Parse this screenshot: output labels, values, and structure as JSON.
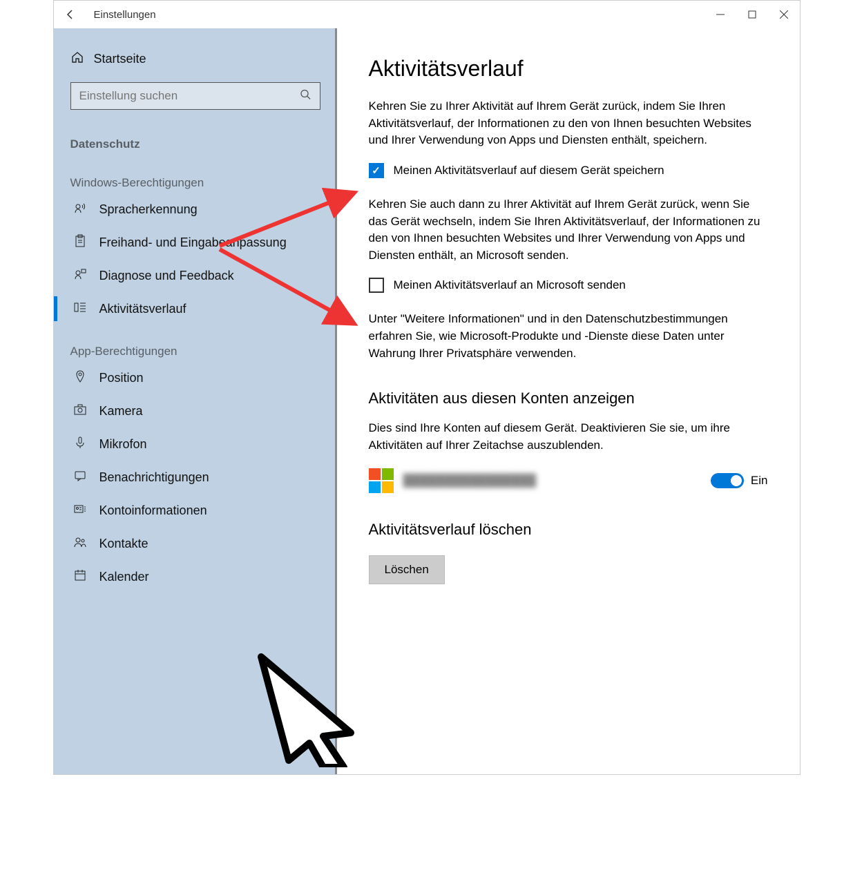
{
  "window": {
    "title": "Einstellungen"
  },
  "sidebar": {
    "home": "Startseite",
    "search_placeholder": "Einstellung suchen",
    "privacy_label": "Datenschutz",
    "section_windows": "Windows-Berechtigungen",
    "section_app": "App-Berechtigungen",
    "items_windows": [
      {
        "label": "Spracherkennung"
      },
      {
        "label": "Freihand- und Eingabeanpassung"
      },
      {
        "label": "Diagnose und Feedback"
      },
      {
        "label": "Aktivitätsverlauf"
      }
    ],
    "items_app": [
      {
        "label": "Position"
      },
      {
        "label": "Kamera"
      },
      {
        "label": "Mikrofon"
      },
      {
        "label": "Benachrichtigungen"
      },
      {
        "label": "Kontoinformationen"
      },
      {
        "label": "Kontakte"
      },
      {
        "label": "Kalender"
      }
    ]
  },
  "main": {
    "h1": "Aktivitätsverlauf",
    "p1": "Kehren Sie zu Ihrer Aktivität auf Ihrem Gerät zurück, indem Sie Ihren Aktivitätsverlauf, der Informationen zu den von Ihnen besuchten Websites und Ihrer Verwendung von Apps und Diensten enthält, speichern.",
    "chk1_label": "Meinen Aktivitätsverlauf auf diesem Gerät speichern",
    "p2": "Kehren Sie auch dann zu Ihrer Aktivität auf Ihrem Gerät zurück, wenn Sie das Gerät wechseln, indem Sie Ihren Aktivitätsverlauf, der Informationen zu den von Ihnen besuchten Websites und Ihrer Verwendung von Apps und Diensten enthält, an Microsoft senden.",
    "chk2_label": "Meinen Aktivitätsverlauf an Microsoft senden",
    "p3": "Unter \"Weitere Informationen\" und in den Datenschutzbestimmungen erfahren Sie, wie Microsoft-Produkte und -Dienste diese Daten unter Wahrung Ihrer Privatsphäre verwenden.",
    "h2_accounts": "Aktivitäten aus diesen Konten anzeigen",
    "p_accounts": "Dies sind Ihre Konten auf diesem Gerät. Deaktivieren Sie sie, um ihre Aktivitäten auf Ihrer Zeitachse auszublenden.",
    "account_name": "████████████████",
    "toggle_on": "Ein",
    "h2_clear": "Aktivitätsverlauf löschen",
    "btn_clear": "Löschen"
  },
  "colors": {
    "accent": "#0078d7"
  }
}
